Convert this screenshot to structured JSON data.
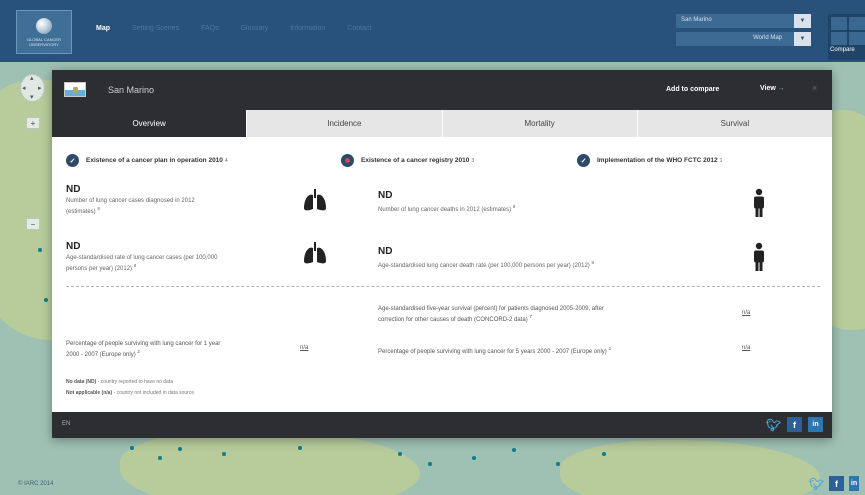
{
  "nav": {
    "logo_text": "GLOBAL CANCER OBSERVATORY",
    "items": [
      "Map",
      "Setting Scenes",
      "FAQs",
      "Glossary",
      "Information",
      "Contact"
    ]
  },
  "selectors": {
    "country": "San Marino",
    "map_type": "World Map",
    "compare_label": "Compare"
  },
  "map_controls": {
    "zoom_in": "+",
    "zoom_out": "−"
  },
  "modal": {
    "country": "San Marino",
    "add_to_compare": "Add to compare",
    "view_label": "View",
    "close": "×",
    "tabs": [
      "Overview",
      "Incidence",
      "Mortality",
      "Survival"
    ],
    "checks": [
      {
        "label": "Existence of a cancer plan in operation 2010",
        "ref": "4",
        "status": "yes"
      },
      {
        "label": "Existence of a cancer registry 2010",
        "ref": "3",
        "status": "no"
      },
      {
        "label": "Implementation of the WHO FCTC 2012",
        "ref": "1",
        "status": "yes"
      }
    ],
    "stats": {
      "cases": {
        "value": "ND",
        "desc_1": "Number of lung cancer cases diagnosed in 2012",
        "desc_2": "(estimates)",
        "ref": "8"
      },
      "deaths": {
        "value": "ND",
        "desc": "Number of lung cancer deaths in 2012 (estimates)",
        "ref": "8"
      },
      "incidence_rate": {
        "value": "ND",
        "desc_1": "Age-standardised rate of lung cancer cases (per 100,000",
        "desc_2": "persons per year) (2012)",
        "ref": "8"
      },
      "death_rate": {
        "value": "ND",
        "desc": "Age-standardised lung cancer death rate (per 100,000 persons per year) (2012)",
        "ref": "8"
      }
    },
    "survival": {
      "five_year_concord_1": "Age-standardised five-year survival (percent) for patients diagnosed 2005-2009, after",
      "five_year_concord_2": "correction for other causes of death (CONCORD-2 data)",
      "five_year_concord_ref": "7",
      "five_year_concord_value": "n/a",
      "one_year_1": "Percentage of people surviving with lung cancer for 1 year",
      "one_year_2": "2000 - 2007 (Europe only)",
      "one_year_ref": "2",
      "one_year_value": "n/a",
      "five_year_europe": "Percentage of people surviving with lung cancer for 5 years 2000 - 2007 (Europe only)",
      "five_year_europe_ref": "2",
      "five_year_europe_value": "n/a"
    },
    "legend": {
      "nd_term": "No data (ND)",
      "nd_desc": "- country reported to have no data",
      "na_term": "Not applicable (n/a)",
      "na_desc": "- country not included in data source"
    },
    "footer_code": "EN"
  },
  "footer": {
    "copyright": "© IARC 2014",
    "social": [
      "twitter-icon",
      "facebook-icon",
      "linkedin-icon"
    ]
  },
  "colors": {
    "nav_bg": "#28527a",
    "modal_dark": "#2c2e31",
    "check_bg": "#2f4a68",
    "registry_no": "#c9475e"
  }
}
